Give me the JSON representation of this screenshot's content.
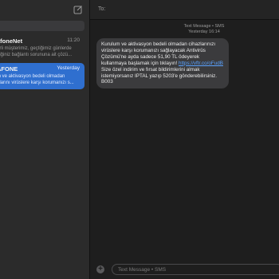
{
  "sidebar": {
    "compose_icon": "compose-icon",
    "conversations": [
      {
        "name": "afoneNet",
        "time": "11:20",
        "preview_1": "erli müşterimiz, geçtiğimiz günlerde",
        "preview_2": "diğiniz bağlantı sorununa ait çözü..."
      },
      {
        "name": "AFONE",
        "time": "Yesterday",
        "preview_1": "m ve aktivasyon bedeli olmadan",
        "preview_2": "nlarını virüslere karşı korumanızı s..."
      }
    ]
  },
  "header": {
    "to_label": "To:"
  },
  "thread": {
    "timestamp_line1": "Text Message • SMS",
    "timestamp_line2": "Yesterday 16:14",
    "message": {
      "text_before_link": "Kurulum ve aktivasyon bedeli olmadan cihazlarınızı virüslere karşı korumanızı sağlayacak Antivirüs Çözümü'ne ayda sadece 51,90 TL ödeyerek kullanmaya başlamak için tıklayın! ",
      "link": "https://vftr.co/oFudB",
      "text_after_link": "Size özel indirim ve fırsat bildirimlerini almak istemiyorsanız IPTAL yazıp 5203'e gönderebilirsiniz. B003"
    }
  },
  "composer": {
    "add_icon": "plus-icon",
    "placeholder": "Text Message • SMS"
  },
  "colors": {
    "selected": "#2f6fcf",
    "bubble": "#3b3b3d",
    "link": "#5aa2ff"
  }
}
